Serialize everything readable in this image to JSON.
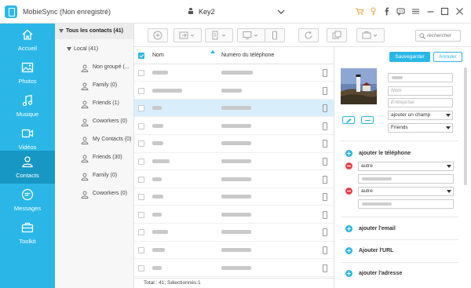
{
  "app": {
    "title": "MobieSync (Non enregistré)",
    "device": "Key2"
  },
  "colors": {
    "accent": "#2ab7e7",
    "accent_dark": "#1797c4",
    "danger": "#e8434c",
    "warn": "#f0a23c"
  },
  "titlebar_icons": [
    "cart-icon",
    "key-icon",
    "facebook-icon",
    "message-icon",
    "menu-icon",
    "minimize-icon",
    "maximize-icon",
    "close-icon"
  ],
  "sidebar": {
    "items": [
      {
        "label": "Accueil",
        "icon": "home-icon"
      },
      {
        "label": "Photos",
        "icon": "photo-icon"
      },
      {
        "label": "Musique",
        "icon": "music-icon"
      },
      {
        "label": "Vidéos",
        "icon": "video-icon"
      },
      {
        "label": "Contacts",
        "icon": "contacts-icon",
        "active": true
      },
      {
        "label": "Messages",
        "icon": "messages-icon"
      },
      {
        "label": "Toolkit",
        "icon": "toolkit-icon"
      }
    ]
  },
  "groups": {
    "all": "Tous les contacts  (41)",
    "local": "Local  (41)",
    "items": [
      "Non groupé  (...",
      "Family  (0)",
      "Friends  (1)",
      "Coworkers  (0)",
      "My Contacts  (0)",
      "Friends  (30)",
      "Family  (0)",
      "Coworkers  (0)"
    ]
  },
  "toolbar": {
    "search_placeholder": "rechercher"
  },
  "list": {
    "col_name": "Nom",
    "col_phone": "Numéro du téléphone",
    "selected_row": 2,
    "status": "Total : 41; Sélectionnés:1"
  },
  "detail": {
    "save": "Sauvegarder",
    "cancel": "Annuler",
    "name_placeholder": "Nom",
    "company_placeholder": "Entreprise",
    "add_field": "ajouter un champ",
    "group_select": "Friends",
    "add_phone": "ajouter le téléphone",
    "phone_type_1": "autre",
    "phone_type_2": "autre",
    "add_email": "ajouter l'email",
    "add_url": "Ajouter l'URL",
    "add_address": "ajouter l'adresse"
  }
}
